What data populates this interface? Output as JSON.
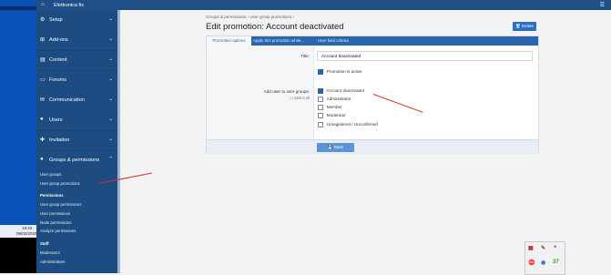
{
  "os": {
    "time": "19:42",
    "date": "09/02/2020"
  },
  "topbar": {
    "home_icon": "⌂",
    "title": "Elettronica fix",
    "menu_icon": "☰"
  },
  "sidebar": {
    "items": [
      {
        "label": "Setup",
        "icon": "⚙",
        "chevron": "⌄"
      },
      {
        "label": "Add-ons",
        "icon": "⊞",
        "chevron": "⌄"
      },
      {
        "label": "Content",
        "icon": "▤",
        "chevron": "⌄"
      },
      {
        "label": "Forums",
        "icon": "▭",
        "chevron": "⌄"
      },
      {
        "label": "Communication",
        "icon": "✉",
        "chevron": "⌄"
      },
      {
        "label": "Users",
        "icon": "●",
        "chevron": "⌄"
      },
      {
        "label": "Invitation",
        "icon": "✚",
        "chevron": "⌄"
      },
      {
        "label": "Groups & permissions",
        "icon": "●",
        "chevron": "⌃"
      }
    ],
    "subitems": {
      "user_groups": "User groups",
      "user_group_promotions": "User group promotions",
      "permissions_heading": "Permissions",
      "user_group_permissions": "User group permissions",
      "user_permissions": "User permissions",
      "node_permissions": "Node permissions",
      "analyze_permissions": "Analyze permissions",
      "staff_heading": "Staff",
      "moderators": "Moderators",
      "administrators": "Administrators"
    }
  },
  "breadcrumb": {
    "part1": "Groups & permissions",
    "sep": "›",
    "part2": "User group promotions",
    "sep2": "›"
  },
  "page": {
    "title": "Edit promotion: Account deactivated",
    "delete_label": "Delete"
  },
  "tabs": [
    "Promotion options",
    "Apply this promotion while...",
    "User field criteria"
  ],
  "form": {
    "title_label": "Title:",
    "title_value": "Account deactivated",
    "active_label": "Promotion is active",
    "groups_label": "Add user to user groups:",
    "select_all": "Select all",
    "groups": [
      {
        "name": "Account deactivated",
        "checked": true
      },
      {
        "name": "Administrator",
        "checked": false
      },
      {
        "name": "Member",
        "checked": false
      },
      {
        "name": "Moderator",
        "checked": false
      },
      {
        "name": "Unregistered / Unconfirmed",
        "checked": false
      }
    ],
    "save_label": "Save"
  },
  "widget": {
    "i1": "▦",
    "i2": "✎",
    "i3": "❝",
    "i4": "⛔",
    "i5": "◉",
    "i6": "37"
  },
  "colors": {
    "sidebar": "#1c4c81",
    "topbar": "#1f4f86",
    "tabs": "#2a65ad",
    "annotation": "#d83030"
  }
}
